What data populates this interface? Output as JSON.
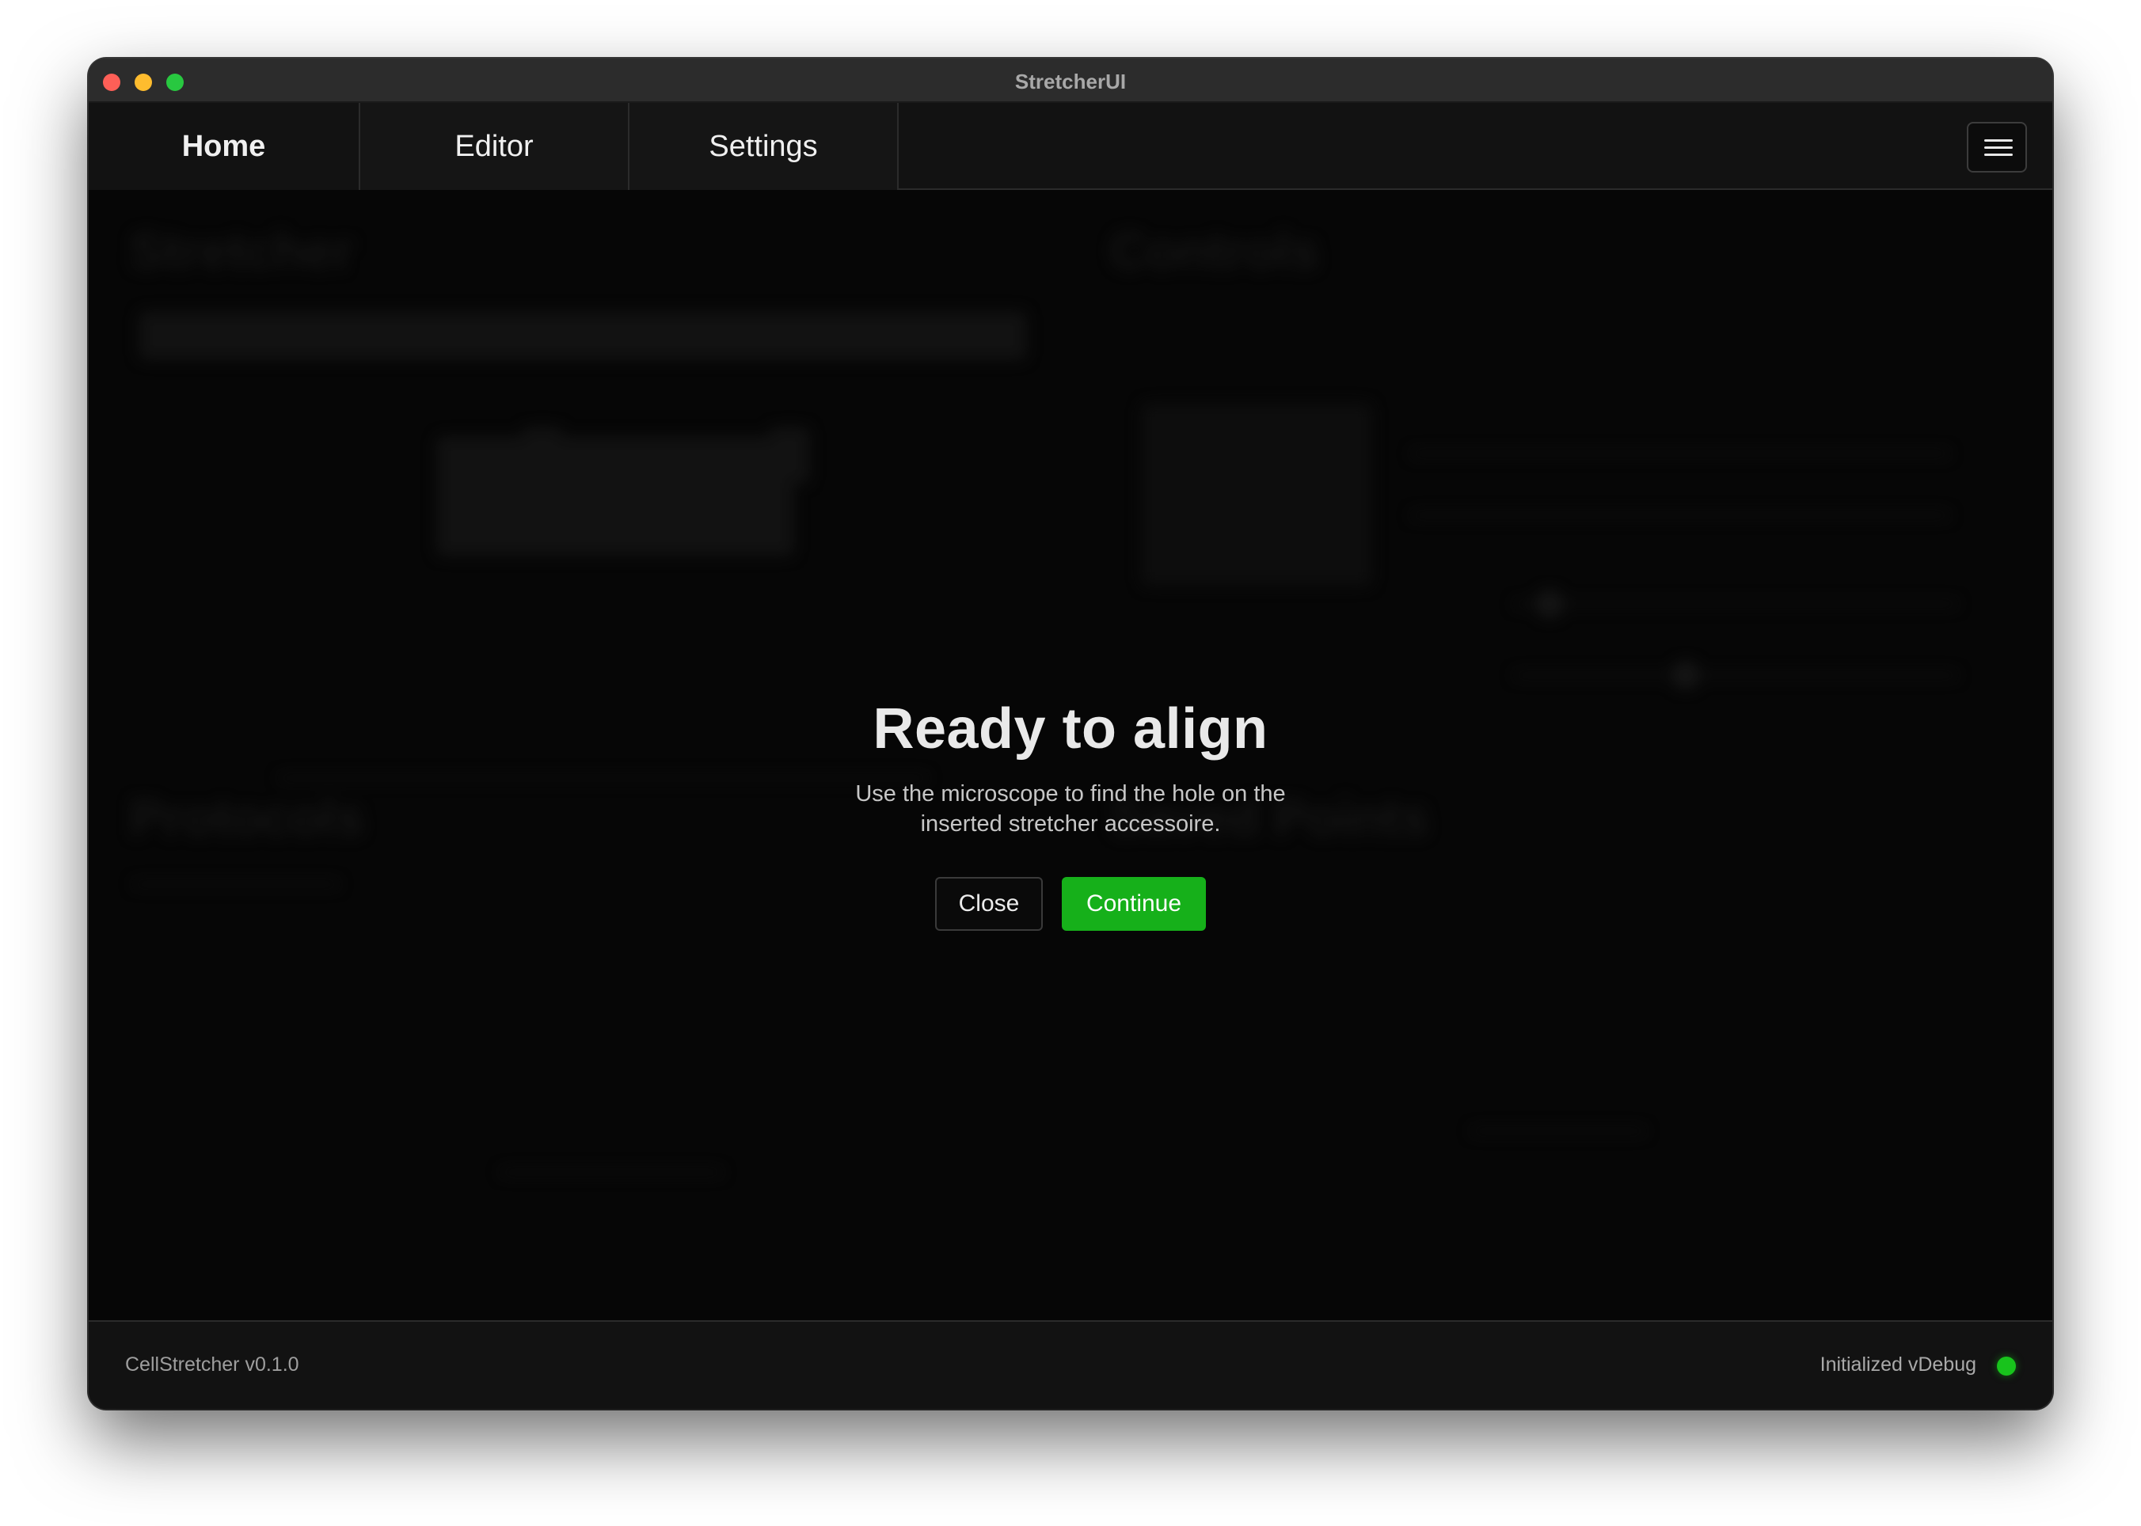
{
  "window": {
    "title": "StretcherUI"
  },
  "tabs": [
    {
      "label": "Home",
      "active": true
    },
    {
      "label": "Editor",
      "active": false
    },
    {
      "label": "Settings",
      "active": false
    }
  ],
  "menu": {
    "icon": "hamburger-menu-icon"
  },
  "background": {
    "panels": [
      "Stretcher",
      "Controls",
      "Protocols",
      "Saved Points"
    ]
  },
  "modal": {
    "title": "Ready to align",
    "description": "Use the microscope to find the hole on the inserted stretcher accessoire.",
    "close_label": "Close",
    "continue_label": "Continue"
  },
  "status": {
    "version": "CellStretcher v0.1.0",
    "state": "Initialized vDebug",
    "indicator_color": "#18c31c"
  },
  "colors": {
    "accent": "#16b01a"
  }
}
